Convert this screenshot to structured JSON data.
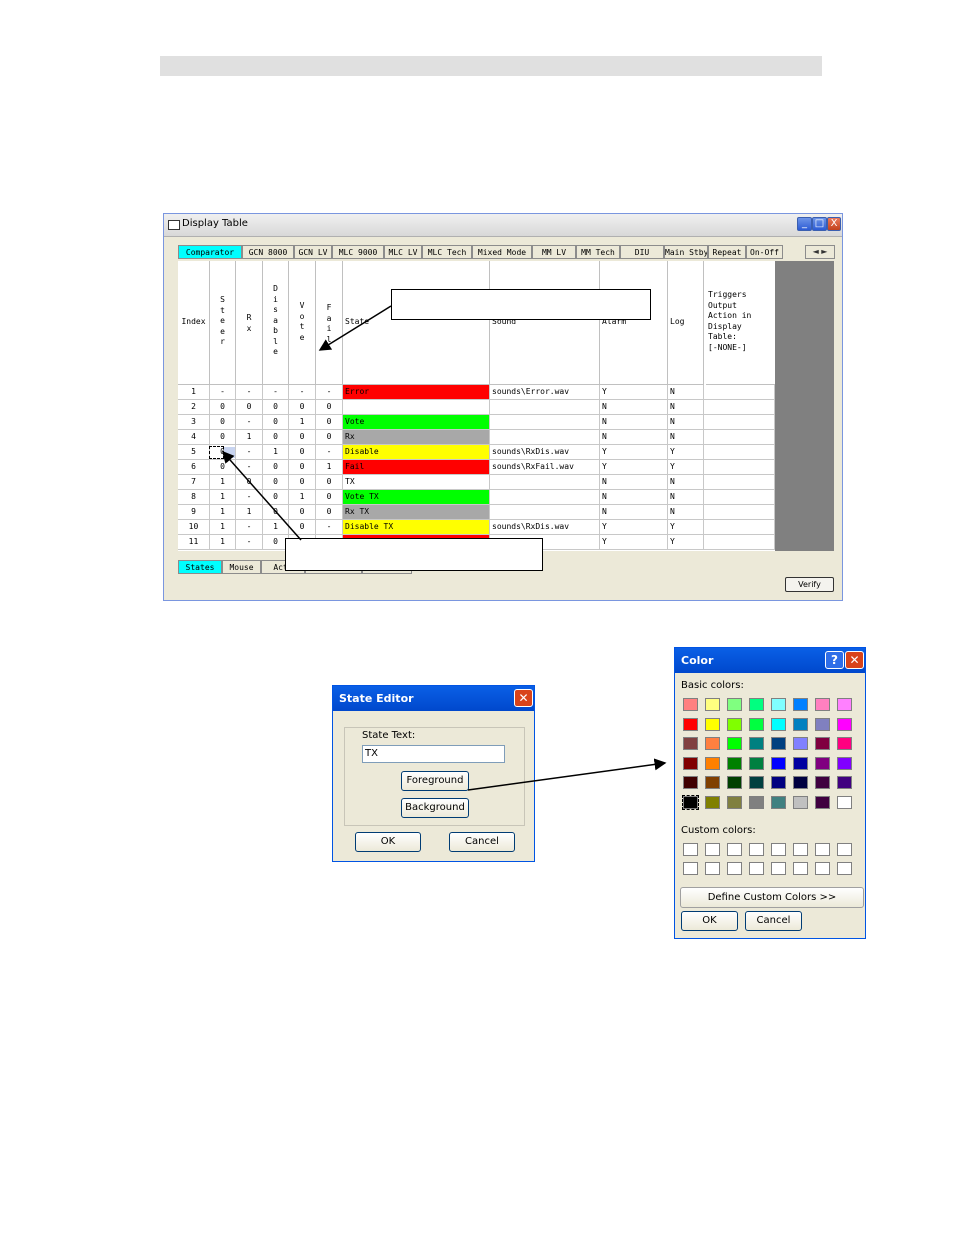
{
  "display_table": {
    "title": "Display Table",
    "window_controls": [
      "_",
      "□",
      "X"
    ],
    "tabs": [
      "Comparator",
      "GCN 8000",
      "GCN LV",
      "MLC 9000",
      "MLC LV",
      "MLC Tech",
      "Mixed Mode",
      "MM LV",
      "MM Tech",
      "DIU",
      "Main Stby",
      "Repeat",
      "On-Off"
    ],
    "tab_scroll": "◄ ►",
    "headers": {
      "index": "Index",
      "steer": "Steer",
      "rx": "Rx",
      "disable": "Disable",
      "vote": "Vote",
      "fail": "Fail",
      "state": "State",
      "sound": "Sound",
      "alarm": "Alarm",
      "log": "Log"
    },
    "triggers_lines": [
      "Triggers",
      "Output",
      "Action in",
      "Display",
      "Table:",
      "[-NONE-]"
    ],
    "rows": [
      {
        "index": "1",
        "steer": "-",
        "rx": "-",
        "disable": "-",
        "vote": "-",
        "fail": "-",
        "state": "Error",
        "color": "#ff0000",
        "sound": "sounds\\Error.wav",
        "alarm": "Y",
        "log": "N"
      },
      {
        "index": "2",
        "steer": "0",
        "rx": "0",
        "disable": "0",
        "vote": "0",
        "fail": "0",
        "state": "",
        "color": "#ffffff",
        "sound": "",
        "alarm": "N",
        "log": "N"
      },
      {
        "index": "3",
        "steer": "0",
        "rx": "-",
        "disable": "0",
        "vote": "1",
        "fail": "0",
        "state": "Vote",
        "color": "#00ff00",
        "sound": "",
        "alarm": "N",
        "log": "N"
      },
      {
        "index": "4",
        "steer": "0",
        "rx": "1",
        "disable": "0",
        "vote": "0",
        "fail": "0",
        "state": "Rx",
        "color": "#a8a8a8",
        "sound": "",
        "alarm": "N",
        "log": "N"
      },
      {
        "index": "5",
        "steer": "0",
        "rx": "-",
        "disable": "1",
        "vote": "0",
        "fail": "-",
        "state": "Disable",
        "color": "#ffff00",
        "sound": "sounds\\RxDis.wav",
        "alarm": "Y",
        "log": "Y"
      },
      {
        "index": "6",
        "steer": "0",
        "rx": "-",
        "disable": "0",
        "vote": "0",
        "fail": "1",
        "state": "Fail",
        "color": "#ff0000",
        "sound": "sounds\\RxFail.wav",
        "alarm": "Y",
        "log": "Y"
      },
      {
        "index": "7",
        "steer": "1",
        "rx": "0",
        "disable": "0",
        "vote": "0",
        "fail": "0",
        "state": "TX",
        "color": "#ffffff",
        "sound": "",
        "alarm": "N",
        "log": "N"
      },
      {
        "index": "8",
        "steer": "1",
        "rx": "-",
        "disable": "0",
        "vote": "1",
        "fail": "0",
        "state": "Vote TX",
        "color": "#00ff00",
        "sound": "",
        "alarm": "N",
        "log": "N"
      },
      {
        "index": "9",
        "steer": "1",
        "rx": "1",
        "disable": "0",
        "vote": "0",
        "fail": "0",
        "state": "Rx TX",
        "color": "#a8a8a8",
        "sound": "",
        "alarm": "N",
        "log": "N"
      },
      {
        "index": "10",
        "steer": "1",
        "rx": "-",
        "disable": "1",
        "vote": "0",
        "fail": "-",
        "state": "Disable TX",
        "color": "#ffff00",
        "sound": "sounds\\RxDis.wav",
        "alarm": "Y",
        "log": "Y"
      },
      {
        "index": "11",
        "steer": "1",
        "rx": "-",
        "disable": "0",
        "vote": "0",
        "fail": "1",
        "state": "",
        "color": "#ff0000",
        "sound": "Fail.wav",
        "alarm": "Y",
        "log": "Y"
      }
    ],
    "bottom_tabs": [
      "States",
      "Mouse",
      "Acti",
      "",
      ""
    ],
    "verify_label": "Verify"
  },
  "state_editor": {
    "title": "State Editor",
    "state_text_label": "State Text:",
    "state_text_value": "TX",
    "foreground_label": "Foreground",
    "background_label": "Background",
    "ok_label": "OK",
    "cancel_label": "Cancel"
  },
  "color_dialog": {
    "title": "Color",
    "basic_colors_label": "Basic colors:",
    "custom_colors_label": "Custom colors:",
    "define_custom_label": "Define Custom Colors >>",
    "ok_label": "OK",
    "cancel_label": "Cancel",
    "basic_colors": [
      "#ff8080",
      "#ffff80",
      "#80ff80",
      "#00ff80",
      "#80ffff",
      "#0080ff",
      "#ff80c0",
      "#ff80ff",
      "#ff0000",
      "#ffff00",
      "#80ff00",
      "#00ff40",
      "#00ffff",
      "#0080c0",
      "#8080c0",
      "#ff00ff",
      "#804040",
      "#ff8040",
      "#00ff00",
      "#008080",
      "#004080",
      "#8080ff",
      "#800040",
      "#ff0080",
      "#800000",
      "#ff8000",
      "#008000",
      "#008040",
      "#0000ff",
      "#0000a0",
      "#800080",
      "#8000ff",
      "#400000",
      "#804000",
      "#004000",
      "#004040",
      "#000080",
      "#000040",
      "#400040",
      "#400080",
      "#000000",
      "#808000",
      "#808040",
      "#808080",
      "#408080",
      "#c0c0c0",
      "#400040",
      "#ffffff"
    ]
  }
}
